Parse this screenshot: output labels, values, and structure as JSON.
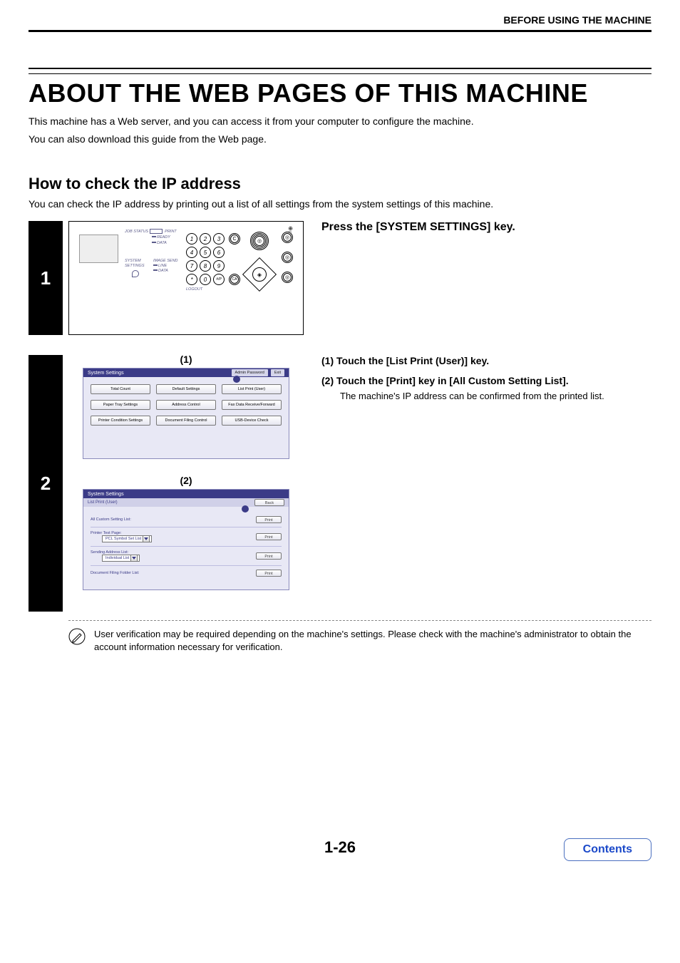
{
  "header": {
    "subtitle": "BEFORE USING THE MACHINE"
  },
  "title": "ABOUT THE WEB PAGES OF THIS MACHINE",
  "intro1": "This machine has a Web server, and you can access it from your computer to configure the machine.",
  "intro2": "You can also download this guide from the Web page.",
  "subheading": "How to check the IP address",
  "sublead": "You can check the IP address by printing out a list of all settings from the system settings of this machine.",
  "step1": {
    "number": "1",
    "title": "Press the [SYSTEM SETTINGS] key.",
    "panel": {
      "job_status": "JOB STATUS",
      "print": "PRINT",
      "ready": "READY",
      "data": "DATA",
      "system_settings": "SYSTEM SETTINGS",
      "image_send": "IMAGE SEND",
      "line": "LINE",
      "data2": "DATA",
      "logout": "LOGOUT",
      "keypad": [
        "1",
        "2",
        "3",
        "4",
        "5",
        "6",
        "7",
        "8",
        "9",
        "*",
        "0",
        "#/P"
      ],
      "clear": "C",
      "ca": "CA"
    }
  },
  "step2": {
    "number": "2",
    "callout1": "(1)",
    "callout2": "(2)",
    "bullets": [
      {
        "marker": "(1)",
        "head": "Touch the [List Print (User)] key."
      },
      {
        "marker": "(2)",
        "head": "Touch the [Print] key in [All Custom Setting List].",
        "body": "The machine's IP address can be confirmed from the printed list."
      }
    ],
    "screen1": {
      "title": "System Settings",
      "admin_pw": "Admin Password",
      "exit": "Exit",
      "buttons": [
        "Total Count",
        "Default Settings",
        "List Print (User)",
        "Paper Tray Settings",
        "Address Control",
        "Fax Data Receive/Forward",
        "Printer Condition Settings",
        "Document Filing Control",
        "USB-Device Check"
      ]
    },
    "screen2": {
      "title": "System Settings",
      "subtitle": "List Print (User)",
      "back": "Back",
      "rows": {
        "all_custom": "All Custom Setting List:",
        "printer_test": "Printer Test Page:",
        "printer_test_sel": "PCL Symbol Set List",
        "sending_addr": "Sending Address List:",
        "sending_addr_sel": "Individual List",
        "doc_filing": "Document Filing Folder List:"
      },
      "print": "Print"
    }
  },
  "note": "User verification may be required depending on the machine's settings. Please check with the machine's administrator to obtain the account information necessary for verification.",
  "footer": {
    "page": "1-26",
    "contents": "Contents"
  }
}
